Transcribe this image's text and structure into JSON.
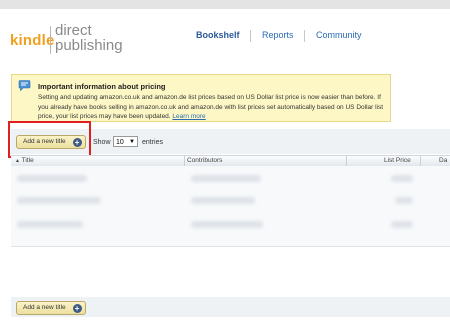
{
  "logo": {
    "kindle": "kindle",
    "direct": "direct",
    "publishing": "publishing"
  },
  "nav": {
    "items": [
      {
        "label": "Bookshelf",
        "active": true
      },
      {
        "label": "Reports",
        "active": false
      },
      {
        "label": "Community",
        "active": false
      }
    ]
  },
  "notice": {
    "title": "Important information about pricing",
    "body": "Setting and updating amazon.co.uk and amazon.de list prices based on US Dollar list price is now easier than before. If you already have books selling in amazon.co.uk and amazon.de with list prices set automatically based on US Dollar list price, your list prices may have been updated.",
    "link": "Learn more",
    "icon": "speech-bubble-icon"
  },
  "toolbar": {
    "add_title_label": "Add a new title",
    "add_icon": "plus-circle-icon",
    "show_label": "Show",
    "entries_value": "10",
    "entries_label": "entries"
  },
  "table": {
    "columns": [
      "Title",
      "Contributors",
      "List Price",
      "Da"
    ],
    "sort_indicator": "▲"
  },
  "footer": {
    "add_title_label": "Add a new title"
  },
  "colors": {
    "accent_red_highlight": "#e02020",
    "link_blue": "#2a6bb3",
    "notice_bg": "#fdf7c6",
    "button_bg": "#ece0a0",
    "kindle_orange": "#f0a020"
  }
}
